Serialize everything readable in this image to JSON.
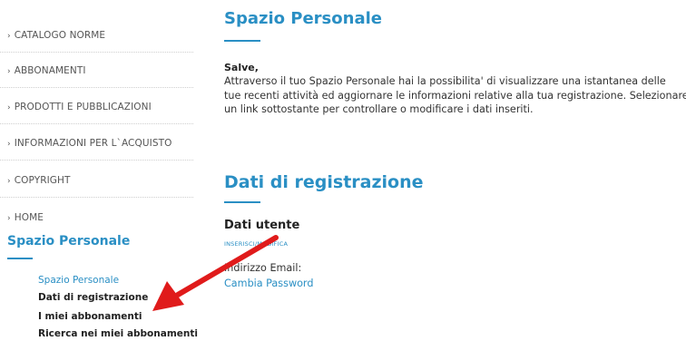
{
  "sidebar": {
    "nav_items": [
      {
        "label": "CATALOGO NORME"
      },
      {
        "label": "ABBONAMENTI"
      },
      {
        "label": "PRODOTTI E PUBBLICAZIONI"
      },
      {
        "label": "INFORMAZIONI PER L`ACQUISTO"
      },
      {
        "label": "COPYRIGHT"
      },
      {
        "label": "HOME"
      }
    ],
    "chevron": "›",
    "section_title": "Spazio Personale",
    "sub_items": [
      {
        "label": "Spazio Personale"
      },
      {
        "label": "Dati di registrazione"
      },
      {
        "label": "I miei abbonamenti"
      },
      {
        "label": "Ricerca nei miei abbonamenti"
      }
    ]
  },
  "main": {
    "title": "Spazio Personale",
    "greeting": "Salve,",
    "intro_lines": [
      "Attraverso il tuo Spazio Personale hai la possibilita' di visualizzare una istantanea delle",
      "tue recenti attività ed aggiornare le informazioni relative alla tua registrazione. Selezionare",
      "un link sottostante per controllare o modificare i dati inseriti."
    ],
    "section_title": "Dati di registrazione",
    "user_data_title": "Dati utente",
    "edit_link": "INSERISCI/MODIFICA",
    "email_label": "Indirizzo Email:",
    "change_password_link": "Cambia Password"
  },
  "colors": {
    "accent": "#2a8fc4",
    "annotation_arrow": "#e01b1b"
  }
}
